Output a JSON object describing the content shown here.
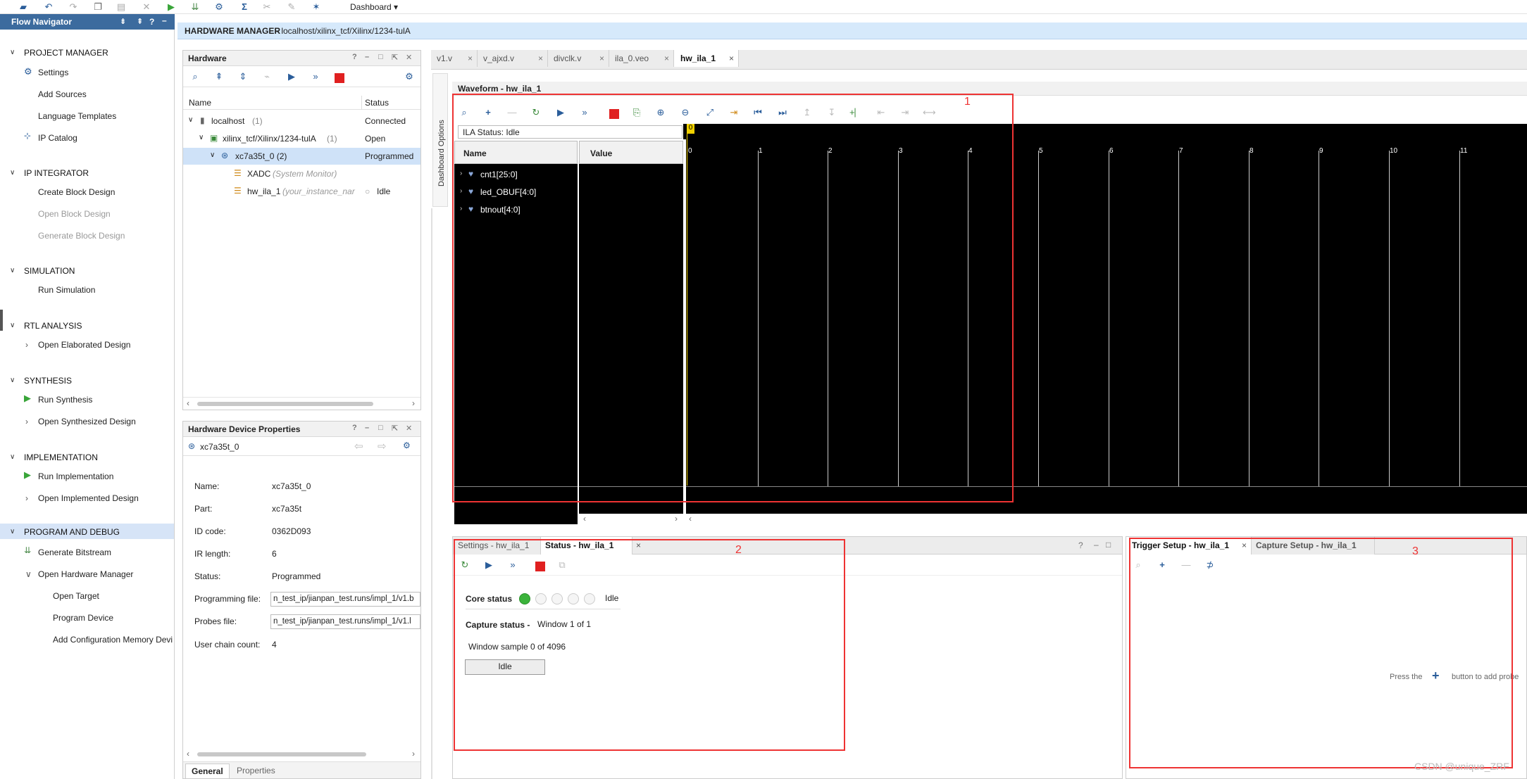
{
  "toolbar": {
    "dashboard_label": "Dashboard"
  },
  "colors": {
    "accent": "#3c6b9e",
    "highlight": "#d6e9fb",
    "play": "#39a539",
    "stop": "#e02020",
    "annotation": "#e33333"
  },
  "flow_navigator": {
    "title": "Flow Navigator",
    "sections": {
      "project_manager": {
        "label": "PROJECT MANAGER",
        "items": [
          "Settings",
          "Add Sources",
          "Language Templates",
          "IP Catalog"
        ]
      },
      "ip_integrator": {
        "label": "IP INTEGRATOR",
        "items": [
          "Create Block Design",
          "Open Block Design",
          "Generate Block Design"
        ]
      },
      "simulation": {
        "label": "SIMULATION",
        "items": [
          "Run Simulation"
        ]
      },
      "rtl_analysis": {
        "label": "RTL ANALYSIS",
        "items": [
          "Open Elaborated Design"
        ]
      },
      "synthesis": {
        "label": "SYNTHESIS",
        "items": [
          "Run Synthesis",
          "Open Synthesized Design"
        ]
      },
      "implementation": {
        "label": "IMPLEMENTATION",
        "items": [
          "Run Implementation",
          "Open Implemented Design"
        ]
      },
      "program_and_debug": {
        "label": "PROGRAM AND DEBUG",
        "items": [
          "Generate Bitstream",
          "Open Hardware Manager",
          "Open Target",
          "Program Device",
          "Add Configuration Memory Devi"
        ]
      }
    }
  },
  "hardware_manager": {
    "title": "HARDWARE MANAGER",
    "path": "- localhost/xilinx_tcf/Xilinx/1234-tulA"
  },
  "hardware": {
    "title": "Hardware",
    "columns": [
      "Name",
      "Status"
    ],
    "rows": [
      {
        "name": "localhost",
        "count": "(1)",
        "status": "Connected"
      },
      {
        "name": "xilinx_tcf/Xilinx/1234-tulA",
        "count": "(1)",
        "status": "Open"
      },
      {
        "name": "xc7a35t_0 (2)",
        "count": "",
        "status": "Programmed"
      },
      {
        "name": "XADC",
        "count": "(System Monitor)",
        "status": ""
      },
      {
        "name": "hw_ila_1",
        "count": "(your_instance_nar",
        "status": "Idle"
      }
    ]
  },
  "device_props": {
    "title": "Hardware Device Properties",
    "device": "xc7a35t_0",
    "rows": [
      {
        "k": "Name:",
        "v": "xc7a35t_0"
      },
      {
        "k": "Part:",
        "v": "xc7a35t"
      },
      {
        "k": "ID code:",
        "v": "0362D093"
      },
      {
        "k": "IR length:",
        "v": "6"
      },
      {
        "k": "Status:",
        "v": "Programmed"
      },
      {
        "k": "Programming file:",
        "v": "n_test_ip/jianpan_test.runs/impl_1/v1.b"
      },
      {
        "k": "Probes file:",
        "v": "n_test_ip/jianpan_test.runs/impl_1/v1.l"
      },
      {
        "k": "User chain count:",
        "v": "4"
      }
    ],
    "tabs": [
      "General",
      "Properties"
    ]
  },
  "editor_tabs": [
    "v1.v",
    "v_ajxd.v",
    "divclk.v",
    "ila_0.veo",
    "hw_ila_1"
  ],
  "dashboard_options": "Dashboard Options",
  "waveform": {
    "title": "Waveform - hw_ila_1",
    "ila_status": "ILA Status:  Idle",
    "col_name": "Name",
    "col_value": "Value",
    "signals": [
      "cnt1[25:0]",
      "led_OBUF[4:0]",
      "btnout[4:0]"
    ],
    "ticks": [
      "0",
      "1",
      "2",
      "3",
      "4",
      "5",
      "6",
      "7",
      "8",
      "9",
      "10",
      "11"
    ],
    "marker": "0"
  },
  "status_panel": {
    "tabs": [
      "Settings - hw_ila_1",
      "Status - hw_ila_1"
    ],
    "core_status_label": "Core status",
    "core_status_value": "Idle",
    "capture_status_label": "Capture status -",
    "capture_status_value": "Window 1 of 1",
    "window_sample": "Window sample 0 of 4096",
    "idle_button": "Idle"
  },
  "trigger_panel": {
    "tabs": [
      "Trigger Setup - hw_ila_1",
      "Capture Setup - hw_ila_1"
    ],
    "hint_before": "Press the",
    "hint_after": "button to add probe"
  },
  "annotations": [
    "1",
    "2",
    "3"
  ],
  "watermark": "CSDN @unique_ZRF"
}
